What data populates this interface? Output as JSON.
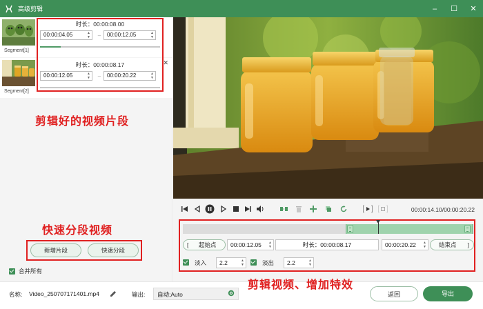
{
  "window": {
    "title": "高级剪辑",
    "min_icon": "minimize-icon",
    "max_icon": "maximize-icon",
    "close_icon": "close-icon",
    "accent_color": "#3e8f57",
    "annotation_color": "#e02020"
  },
  "segments": [
    {
      "name": "Segment[1]",
      "duration": "时长：00:00:08.00",
      "start": "00:00:04.05",
      "end": "00:00:12.05",
      "separator": "–",
      "progress": 0.17
    },
    {
      "name": "Segment[2]",
      "duration": "时长：00:00:08.17",
      "start": "00:00:12.05",
      "end": "00:00:20.22",
      "separator": "–",
      "progress": 0.0
    }
  ],
  "annotations": {
    "segments": "剪辑好的视频片段",
    "split": "快速分段视频",
    "edit": "剪辑视频、增加特效"
  },
  "left_actions": {
    "add_segment": "新增片段",
    "quick_split": "快速分段",
    "merge_all": "合并所有"
  },
  "player": {
    "timecode": "00:00:14.10/00:00:20.22"
  },
  "trim": {
    "start_label": "起始点",
    "start_value": "00:00:12.05",
    "duration": "时长：00:00:08.17",
    "end_value": "00:00:20.22",
    "end_label": "结束点",
    "bracket_open": "[",
    "bracket_close": "]",
    "selection_start": 0.56,
    "selection_end": 0.995,
    "playhead": 0.67
  },
  "effects": {
    "fade_in_label": "淡入",
    "fade_in_value": "2.2",
    "fade_out_label": "淡出",
    "fade_out_value": "2.2"
  },
  "footer": {
    "name_label": "名称:",
    "file_name": "Video_250707171401.mp4",
    "output_label": "输出:",
    "output_value": "自动;Auto",
    "back_button": "返回",
    "export_button": "导出"
  }
}
